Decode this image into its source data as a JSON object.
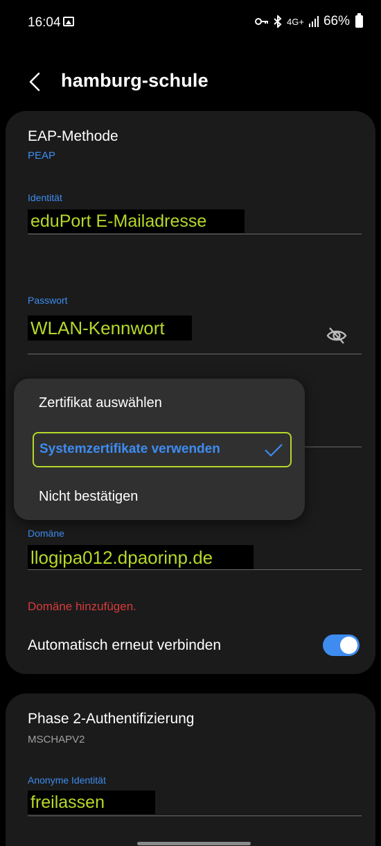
{
  "status_bar": {
    "time": "16:04",
    "network_label": "4G+",
    "battery": "66%"
  },
  "header": {
    "title": "hamburg-schule"
  },
  "card1": {
    "eap_label": "EAP-Methode",
    "eap_value": "PEAP",
    "identity_label": "Identität",
    "identity_value": "eduPort E-Mailadresse",
    "password_label": "Passwort",
    "password_value": "WLAN-Kennwort",
    "domain_label": "Domäne",
    "domain_value": "llogipa012.dpaorinp.de",
    "domain_error": "Domäne hinzufügen.",
    "auto_reconnect_label": "Automatisch erneut verbinden",
    "auto_reconnect_on": true
  },
  "card2": {
    "phase2_label": "Phase 2-Authentifizierung",
    "phase2_value": "MSCHAPV2",
    "anon_label": "Anonyme Identität",
    "anon_value": "freilassen"
  },
  "ca_popup": {
    "options": [
      "Zertifikat auswählen",
      "Systemzertifikate verwenden",
      "Nicht bestätigen"
    ],
    "selected_index": 1
  },
  "colors": {
    "accent": "#3e8cf0",
    "highlight": "#b5d82a",
    "error": "#d83b3b"
  }
}
